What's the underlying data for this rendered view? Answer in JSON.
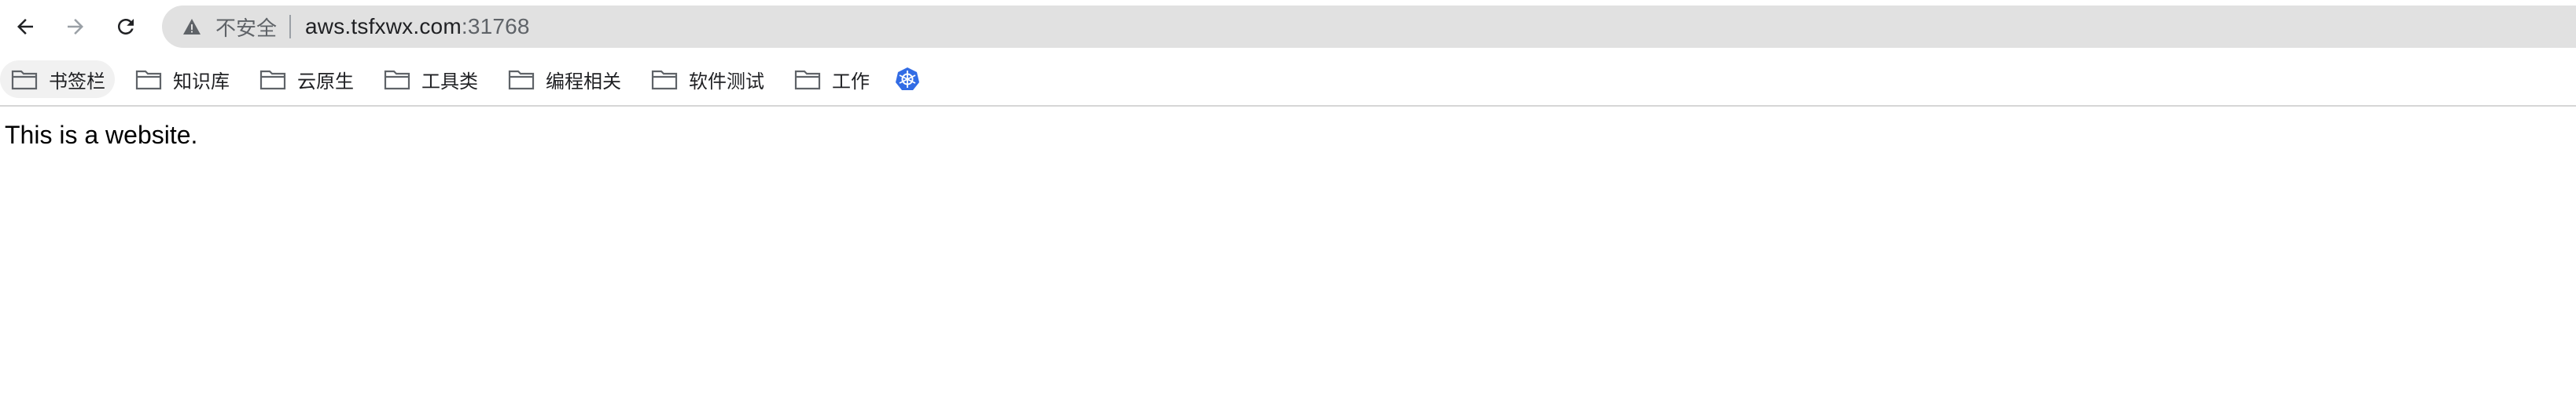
{
  "toolbar": {
    "back_icon": "arrow-left-icon",
    "forward_icon": "arrow-right-icon",
    "reload_icon": "reload-icon"
  },
  "omnibox": {
    "security_icon": "warning-triangle-icon",
    "security_label": "不安全",
    "url_host": "aws.tsfxwx.com",
    "url_port": ":31768"
  },
  "bookmarks": {
    "items": [
      {
        "label": "书签栏",
        "icon": "folder-icon"
      },
      {
        "label": "知识库",
        "icon": "folder-icon"
      },
      {
        "label": "云原生",
        "icon": "folder-icon"
      },
      {
        "label": "工具类",
        "icon": "folder-icon"
      },
      {
        "label": "编程相关",
        "icon": "folder-icon"
      },
      {
        "label": "软件测试",
        "icon": "folder-icon"
      },
      {
        "label": "工作",
        "icon": "folder-icon"
      }
    ],
    "extra_icon": "kubernetes-icon"
  },
  "page": {
    "body_text": "This is a website."
  },
  "colors": {
    "omnibox_bg": "#e1e1e1",
    "text_primary": "#202124",
    "text_secondary": "#5f6368",
    "kubernetes_blue": "#326ce5"
  }
}
